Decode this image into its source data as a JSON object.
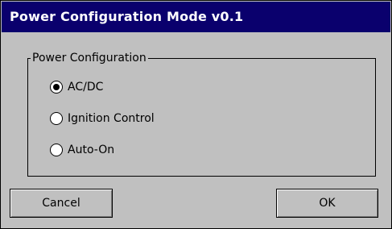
{
  "window": {
    "title": "Power Configuration Mode v0.1"
  },
  "group": {
    "label": "Power Configuration",
    "options": [
      {
        "label": "AC/DC",
        "checked": true
      },
      {
        "label": "Ignition Control",
        "checked": false
      },
      {
        "label": "Auto-On",
        "checked": false
      }
    ]
  },
  "buttons": {
    "cancel": "Cancel",
    "ok": "OK"
  },
  "colors": {
    "titlebar": "#0a006d",
    "background": "#c0c0c0"
  }
}
